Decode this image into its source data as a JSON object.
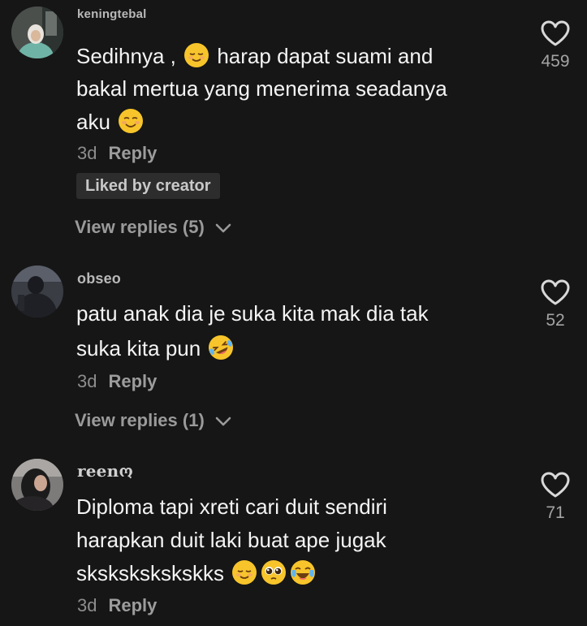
{
  "comments": [
    {
      "username": "keningtebal",
      "lines": [
        "Sedihnya ,",
        "harap dapat suami and",
        "bakal mertua yang menerima seadanya",
        "aku"
      ],
      "time": "3d",
      "reply_label": "Reply",
      "badge": "Liked by creator",
      "view_replies": "View replies (5)",
      "likes": "459"
    },
    {
      "username": "obseo",
      "lines": [
        "patu anak dia je suka kita mak dia tak",
        "suka kita pun"
      ],
      "time": "3d",
      "reply_label": "Reply",
      "view_replies": "View replies (1)",
      "likes": "52"
    },
    {
      "username": "reenო",
      "lines": [
        "Diploma tapi xreti cari duit sendiri",
        "harapkan duit laki buat ape jugak",
        "skskskskskskks"
      ],
      "time": "3d",
      "reply_label": "Reply",
      "likes": "71"
    }
  ],
  "icons": {
    "like": "heart-outline-icon",
    "expand": "chevron-down-icon",
    "emoji_relieved": "relieved-face-emoji",
    "emoji_smiling": "smiling-face-emoji",
    "emoji_rofl": "rolling-on-floor-laughing-emoji",
    "emoji_pleading": "pleading-face-emoji",
    "emoji_joy": "face-with-tears-of-joy-emoji"
  },
  "colors": {
    "background": "#161616",
    "text_primary": "#f4f4f4",
    "text_secondary": "#8d8d8d",
    "badge_bg": "#2d2d2d",
    "emoji_yellow": "#f7c52b"
  }
}
